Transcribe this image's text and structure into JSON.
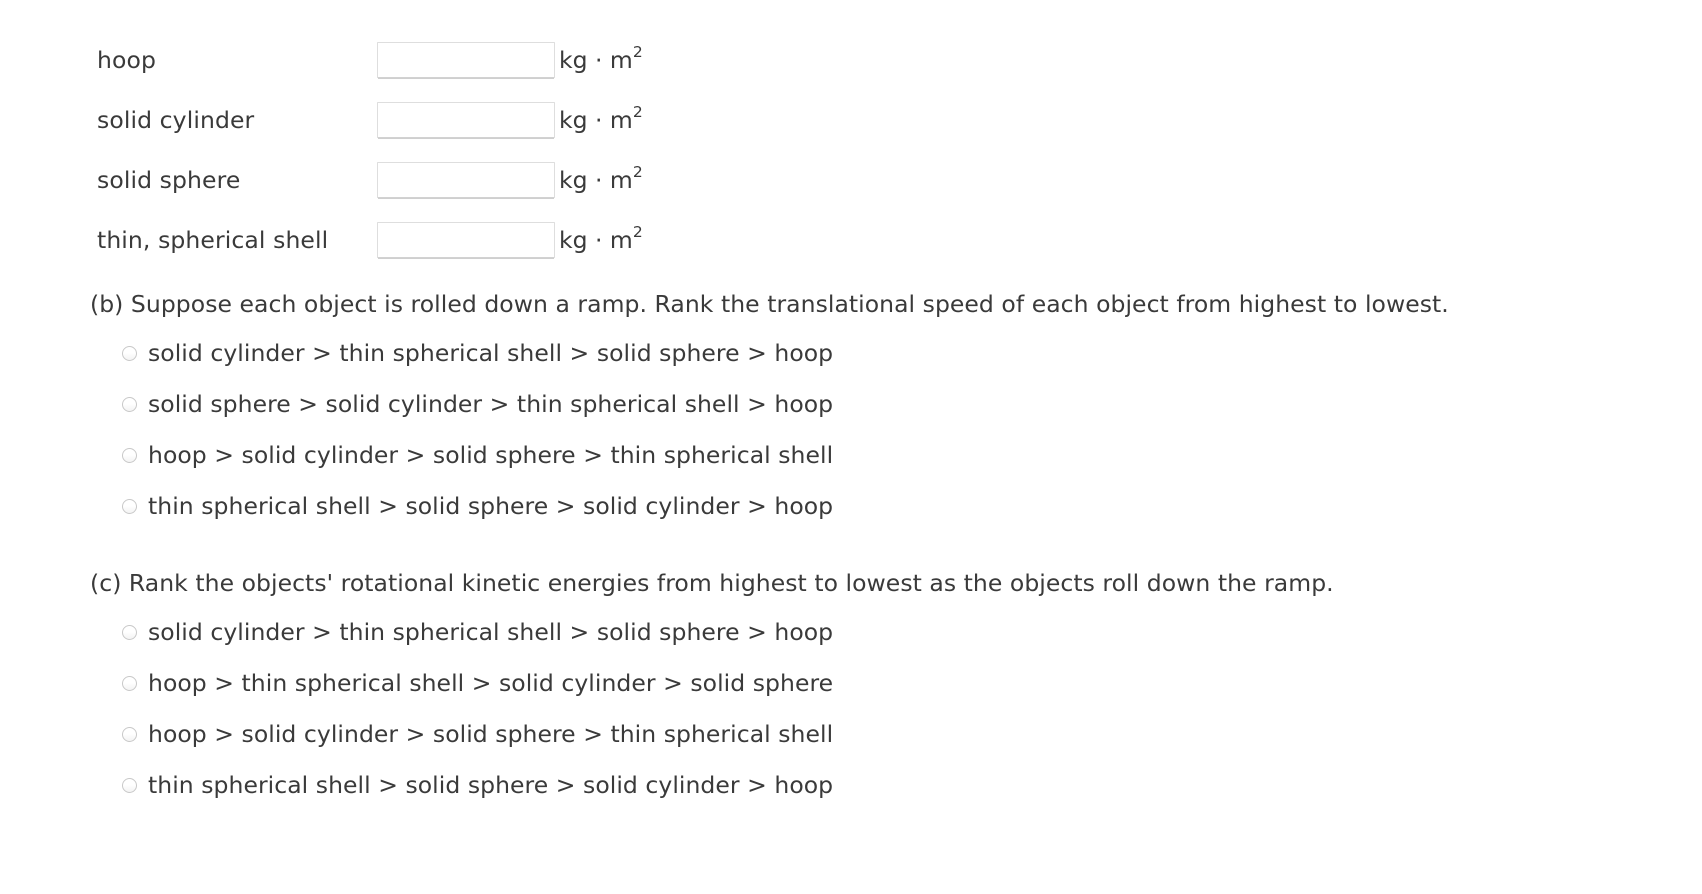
{
  "units": {
    "base": "kg · m",
    "exponent": "2"
  },
  "inertia_table": {
    "rows": [
      {
        "label": "hoop",
        "value": "",
        "placeholder": "",
        "units_base": "kg · m",
        "units_exp": "2"
      },
      {
        "label": "solid cylinder",
        "value": "",
        "placeholder": "",
        "units_base": "kg · m",
        "units_exp": "2"
      },
      {
        "label": "solid sphere",
        "value": "",
        "placeholder": "",
        "units_base": "kg · m",
        "units_exp": "2"
      },
      {
        "label": "thin, spherical shell",
        "value": "",
        "placeholder": "",
        "units_base": "kg · m",
        "units_exp": "2"
      }
    ]
  },
  "question_b": {
    "prompt": "(b) Suppose each object is rolled down a ramp. Rank the translational speed of each object from highest to lowest.",
    "options": [
      {
        "label": "solid cylinder > thin spherical shell > solid sphere > hoop",
        "selected": false
      },
      {
        "label": "solid sphere > solid cylinder > thin spherical shell > hoop",
        "selected": false
      },
      {
        "label": "hoop > solid cylinder > solid sphere > thin spherical shell",
        "selected": false
      },
      {
        "label": "thin spherical shell > solid sphere > solid cylinder > hoop",
        "selected": false
      }
    ]
  },
  "question_c": {
    "prompt": "(c) Rank the objects' rotational kinetic energies from highest to lowest as the objects roll down the ramp.",
    "options": [
      {
        "label": "solid cylinder > thin spherical shell > solid sphere > hoop",
        "selected": false
      },
      {
        "label": "hoop > thin spherical shell > solid cylinder > solid sphere",
        "selected": false
      },
      {
        "label": "hoop > solid cylinder > solid sphere > thin spherical shell",
        "selected": false
      },
      {
        "label": "thin spherical shell > solid sphere > solid cylinder > hoop",
        "selected": false
      }
    ]
  },
  "colors": {
    "text": "#3a3a3a",
    "field_border": "#dedede",
    "radio_border": "#c8c8c8",
    "background": "#ffffff"
  }
}
